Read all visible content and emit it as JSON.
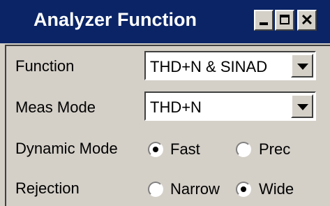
{
  "window": {
    "title": "Analyzer Function"
  },
  "controls": {
    "function_label": "Function",
    "function_value": "THD+N & SINAD",
    "meas_mode_label": "Meas Mode",
    "meas_mode_value": "THD+N",
    "dynamic_mode_label": "Dynamic Mode",
    "dynamic_options": [
      {
        "label": "Fast",
        "selected": true
      },
      {
        "label": "Prec",
        "selected": false
      }
    ],
    "rejection_label": "Rejection",
    "rejection_options": [
      {
        "label": "Narrow",
        "selected": false
      },
      {
        "label": "Wide",
        "selected": true
      }
    ]
  }
}
